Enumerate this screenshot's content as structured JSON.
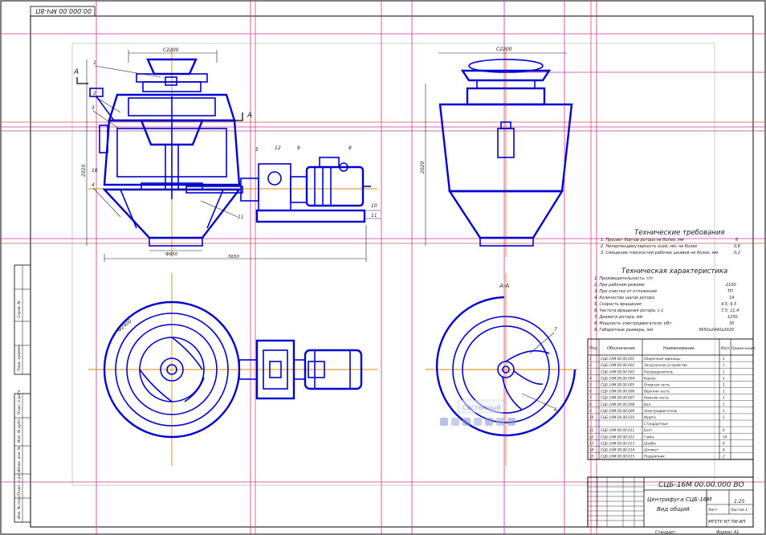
{
  "stamp_top": "00.000.00 МЧ-8П",
  "dims": {
    "top_width_left": "С2200",
    "top_width_right": "С2200",
    "height_left": "2020",
    "height_right": "2020",
    "bottom_width": "Ф650",
    "total_width": "5650",
    "ring_diameter": "Ф2400"
  },
  "section": {
    "mark": "A",
    "view_label": "А-А"
  },
  "callouts": [
    "1",
    "2",
    "3",
    "4",
    "5",
    "6",
    "7",
    "8",
    "9",
    "10",
    "11",
    "12",
    "16"
  ],
  "tech_requirements": {
    "title": "Технические требования",
    "items": [
      "1. Просвет бортов ротора не более, мм",
      "2. Неперпендикулярность осей, мм, не более",
      "3. Смещение плоскостей рабочих шкивов не более, мм"
    ],
    "values": [
      "6",
      "0,8",
      "0,2"
    ]
  },
  "tech_characteristics": {
    "title": "Техническая характеристика",
    "items": [
      "1. Производительность, т/ч",
      "2. При рабочем режиме",
      "3. При очистке от отложений",
      "4. Количество шагов ротора",
      "5. Скорость вращения",
      "6. Частота вращения ротора, с-1",
      "7. Диаметр ротора, мм",
      "8. Мощность электродвигателя, кВт",
      "9. Габаритные размеры, мм"
    ],
    "values": [
      "2100",
      "ТП",
      "14",
      "4,5; 9,5",
      "7,5; 11,4",
      "1250",
      "30",
      "5650х2440х2020"
    ]
  },
  "spec_table": {
    "headers": [
      "Поз.",
      "Обозначение",
      "Наименование",
      "Кол.",
      "Примечание"
    ],
    "rows": [
      [
        "1",
        "СЦБ-16М.00.00.001",
        "Сборочные единицы",
        "1",
        ""
      ],
      [
        "2",
        "СЦБ-16М.00.00.002",
        "Загрузочное устройство",
        "1",
        ""
      ],
      [
        "3",
        "СЦБ-16М.00.00.003",
        "Распределитель",
        "1",
        ""
      ],
      [
        "4",
        "СЦБ-16М.00.00.004",
        "Корпус",
        "1",
        ""
      ],
      [
        "5",
        "СЦБ-16М.00.00.005",
        "Опорная часть",
        "1",
        ""
      ],
      [
        "6",
        "СЦБ-16М.00.00.006",
        "Верхняя часть",
        "1",
        ""
      ],
      [
        "7",
        "СЦБ-16М.00.00.007",
        "Нижняя часть",
        "1",
        ""
      ],
      [
        "8",
        "СЦБ-16М.00.00.008",
        "Вал",
        "1",
        ""
      ],
      [
        "9",
        "СЦБ-16М.00.00.009",
        "Электродвигатель",
        "1",
        ""
      ],
      [
        "10",
        "СЦБ-16М.00.00.010",
        "Муфта",
        "1",
        ""
      ],
      [
        "",
        "",
        "Стандартные",
        "",
        ""
      ],
      [
        "11",
        "СЦБ-16М.00.00.011",
        "Болт",
        "6",
        ""
      ],
      [
        "12",
        "СЦБ-16М.00.00.012",
        "Гайка",
        "14",
        ""
      ],
      [
        "13",
        "СЦБ-16М.00.00.013",
        "Шайба",
        "8",
        ""
      ],
      [
        "14",
        "СЦБ-16М.00.00.014",
        "Шплинт",
        "6",
        ""
      ],
      [
        "15",
        "СЦБ-16М.00.00.015",
        "Подшипник",
        "2",
        ""
      ]
    ]
  },
  "title_block": {
    "designation": "СЦБ-16М 00.00.000 ВО",
    "name_line1": "Центрифуга СЦБ-16М",
    "name_line2": "Вид общий",
    "scale": "1:25",
    "sheet": "Лист",
    "sheets": "Листов 1",
    "org": "МГУТУ ВТ ПИ-8П",
    "bottom_label": "Формат А1",
    "format_small": "Стандарт"
  },
  "overlay": {
    "label": "Системный"
  },
  "left_strip": [
    "Перв. примен.",
    "Справ. №",
    "Подп. и дата",
    "Инв. № дубл.",
    "Взам. инв. №",
    "Подп. и дата",
    "Инв. № подл."
  ],
  "colors": {
    "drawing": "#0000d0",
    "guide_magenta": "#c23a9a",
    "guide_red": "#e05050",
    "centerline": "#e08a00"
  }
}
